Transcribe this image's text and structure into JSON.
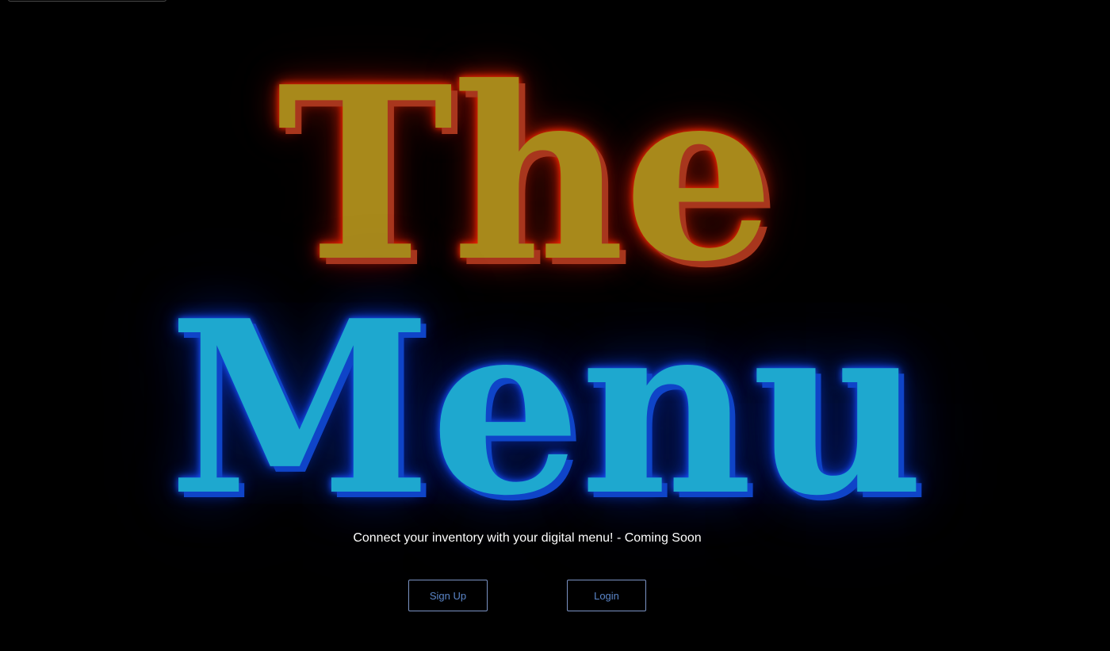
{
  "hero": {
    "title_line1": "The",
    "title_line2": "Menu",
    "tagline": "Connect your inventory with your digital menu! - Coming Soon"
  },
  "actions": {
    "signup_label": "Sign Up",
    "login_label": "Login"
  },
  "colors": {
    "background": "#000000",
    "the_fill": "#a8891b",
    "the_glow": "#ff2a00",
    "menu_fill": "#1ea8cf",
    "menu_glow": "#1a55ff",
    "button_text": "#5b86c9",
    "button_border": "#7b93c4"
  }
}
